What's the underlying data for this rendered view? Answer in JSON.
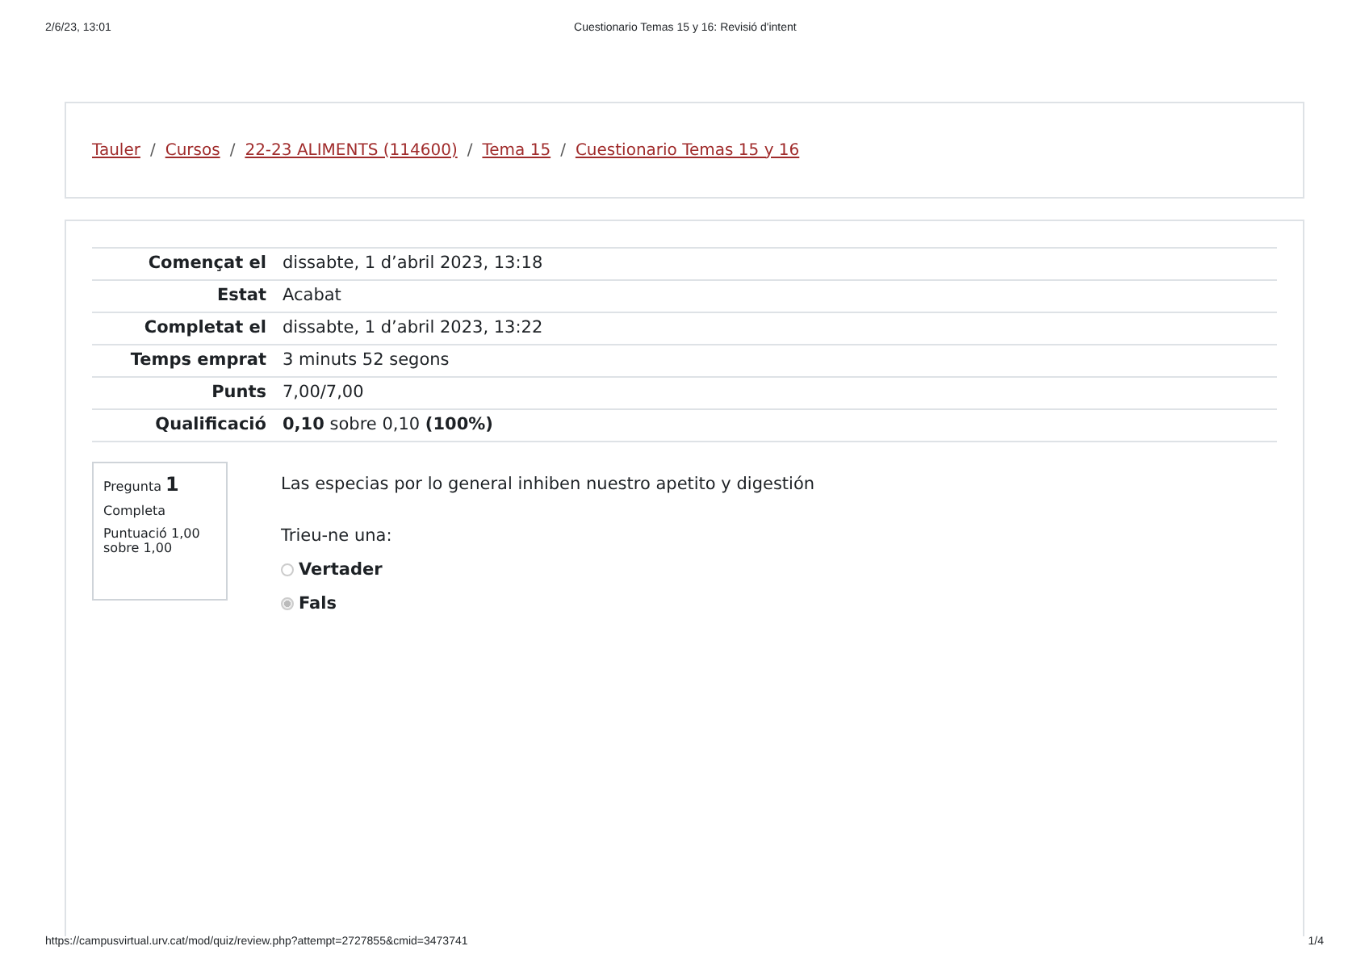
{
  "print_header": {
    "date": "2/6/23, 13:01",
    "title": "Cuestionario Temas 15 y 16: Revisió d'intent"
  },
  "breadcrumb": {
    "separator": "/",
    "items": [
      "Tauler",
      "Cursos",
      "22-23 ALIMENTS (114600)",
      "Tema 15",
      "Cuestionario Temas 15 y 16"
    ]
  },
  "summary": [
    {
      "label": "Començat el",
      "value": "dissabte, 1 d’abril 2023, 13:18"
    },
    {
      "label": "Estat",
      "value": "Acabat"
    },
    {
      "label": "Completat el",
      "value": "dissabte, 1 d’abril 2023, 13:22"
    },
    {
      "label": "Temps emprat",
      "value": "3 minuts 52 segons"
    },
    {
      "label": "Punts",
      "value": "7,00/7,00"
    },
    {
      "label": "Qualificació",
      "value": "**0,10** sobre 0,10 **(100%)**"
    }
  ],
  "question": {
    "label": "Pregunta",
    "number": "1",
    "status": "Completa",
    "score": "Puntuació 1,00 sobre 1,00",
    "text": "Las especias por lo general inhiben nuestro apetito y digestión",
    "prompt": "Trieu-ne una:",
    "options": [
      {
        "label": "Vertader",
        "selected": false
      },
      {
        "label": "Fals",
        "selected": true
      }
    ]
  },
  "print_footer": {
    "url": "https://campusvirtual.urv.cat/mod/quiz/review.php?attempt=2727855&cmid=3473741",
    "page": "1/4"
  }
}
